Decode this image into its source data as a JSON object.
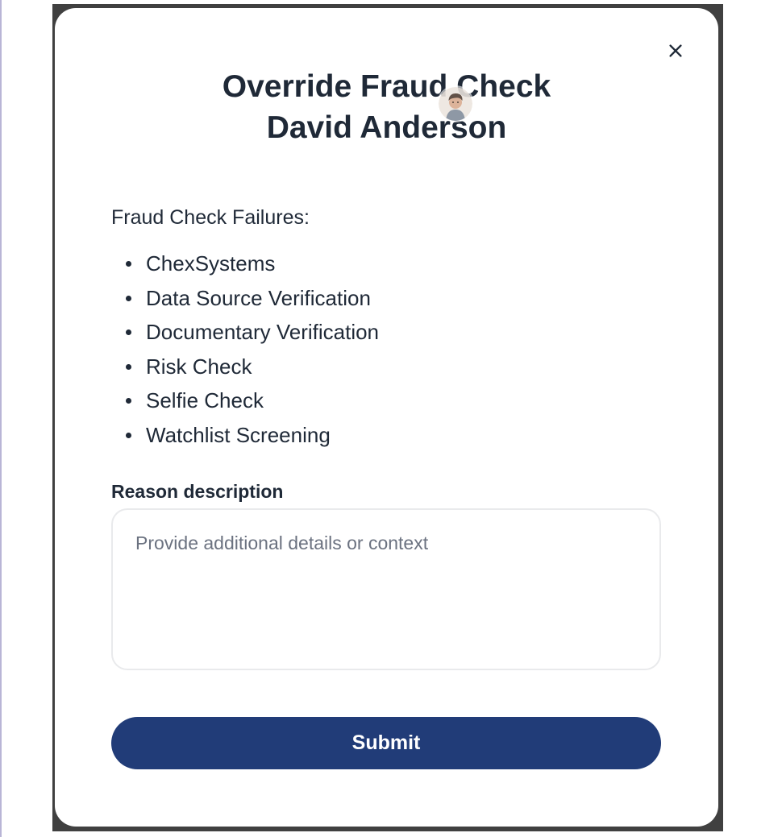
{
  "modal": {
    "title_line1": "Override Fraud Check",
    "title_line2": "David Anderson",
    "close_icon": "close-icon",
    "avatar_icon": "avatar"
  },
  "failures": {
    "heading": "Fraud Check Failures:",
    "items": [
      "ChexSystems",
      "Data Source Verification",
      "Documentary Verification",
      "Risk Check",
      "Selfie Check",
      "Watchlist Screening"
    ]
  },
  "reason": {
    "label": "Reason description",
    "value": "",
    "placeholder": "Provide additional details or context"
  },
  "actions": {
    "submit_label": "Submit"
  },
  "colors": {
    "backdrop": "#404040",
    "modal_background": "#ffffff",
    "text_primary": "#1f2937",
    "placeholder": "#6b7280",
    "input_border": "#e9eaec",
    "primary_button": "#213c78",
    "primary_button_text": "#ffffff"
  }
}
